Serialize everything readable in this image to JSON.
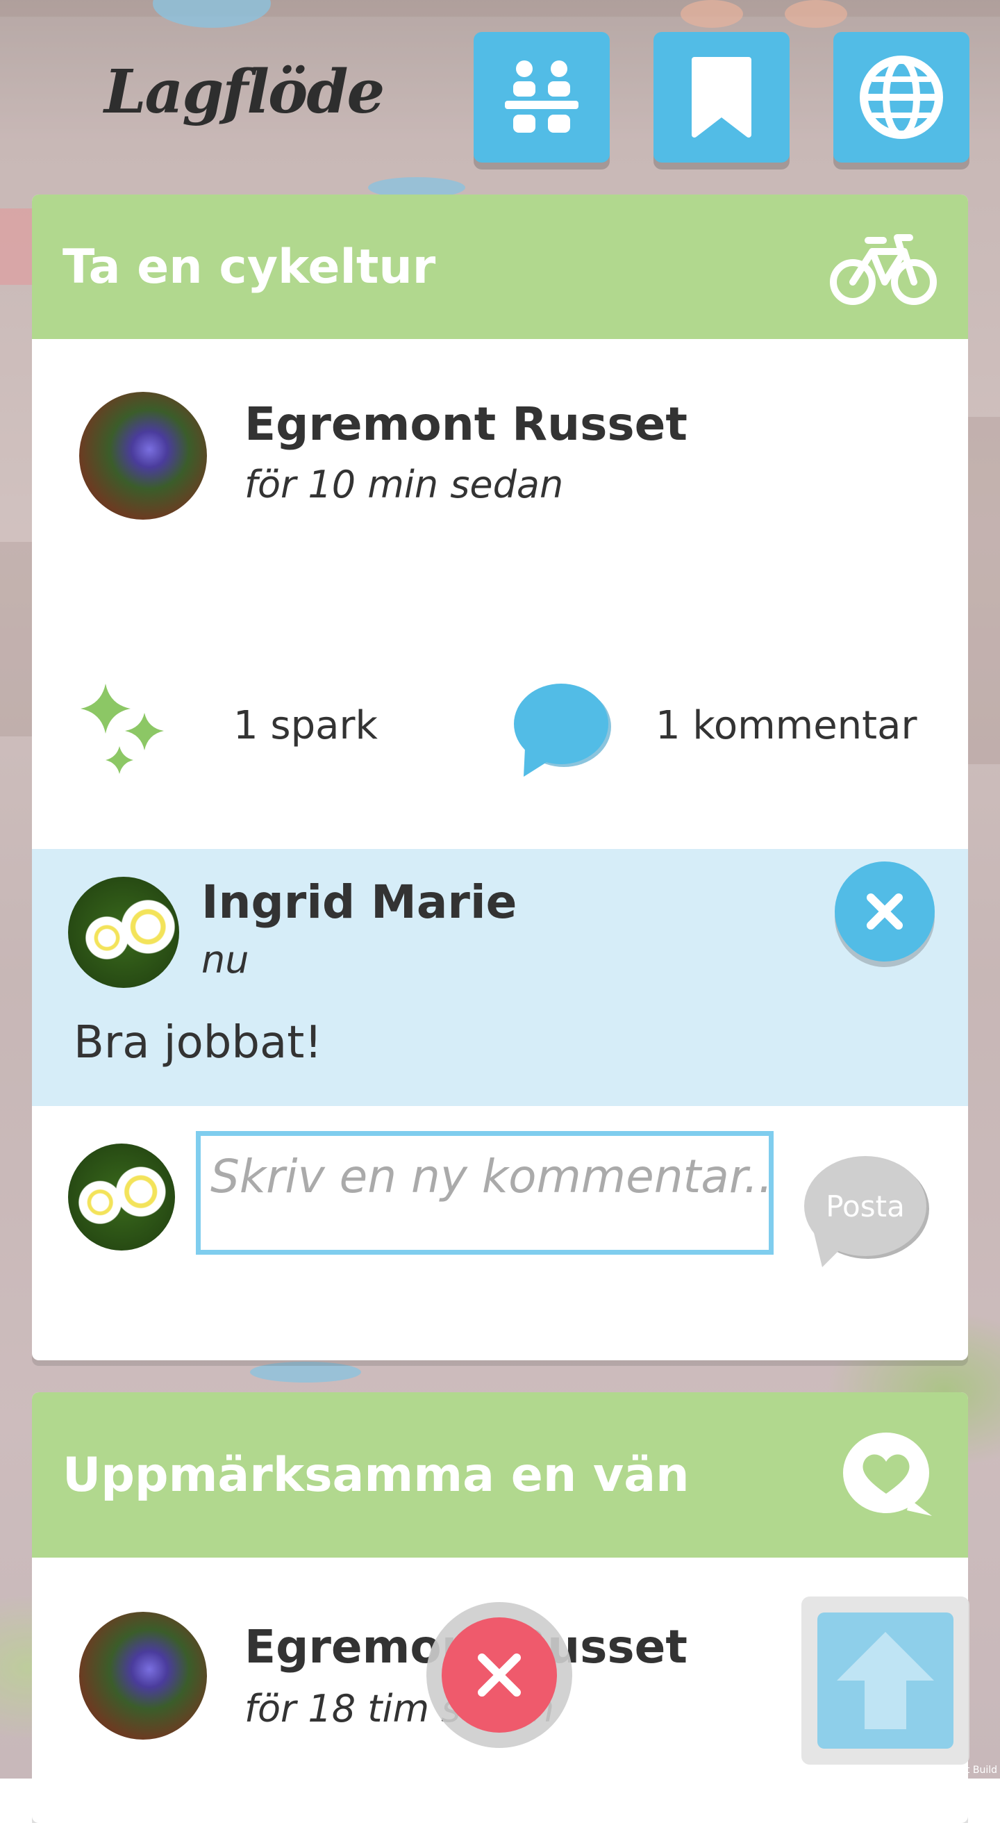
{
  "header": {
    "logo_text": "Lagflöde",
    "buttons": [
      {
        "name": "team-button",
        "icon": "team-icon"
      },
      {
        "name": "bookmark-button",
        "icon": "bookmark-icon"
      },
      {
        "name": "globe-button",
        "icon": "globe-icon"
      }
    ]
  },
  "colors": {
    "accent_blue": "#52bce6",
    "header_green": "#b1d88e",
    "comment_bg": "#d6edf8",
    "spark_green": "#8cc765",
    "close_red": "#ef5a6c"
  },
  "posts": [
    {
      "title": "Ta en cykeltur",
      "icon": "bicycle-icon",
      "author": "Egremont Russet",
      "time": "för 10 min sedan",
      "sparks_label": "1 spark",
      "comments_label": "1 kommentar",
      "comments": [
        {
          "author": "Ingrid Marie",
          "time": "nu",
          "text": "Bra jobbat!"
        }
      ],
      "new_comment": {
        "placeholder": "Skriv en ny kommentar...",
        "post_label": "Posta"
      }
    },
    {
      "title": "Uppmärksamma en vän",
      "icon": "heart-speech-icon",
      "author": "Egremont Russet",
      "time": "för 18 tim sedan"
    }
  ],
  "footer": {
    "dev_label": "Development Build"
  }
}
